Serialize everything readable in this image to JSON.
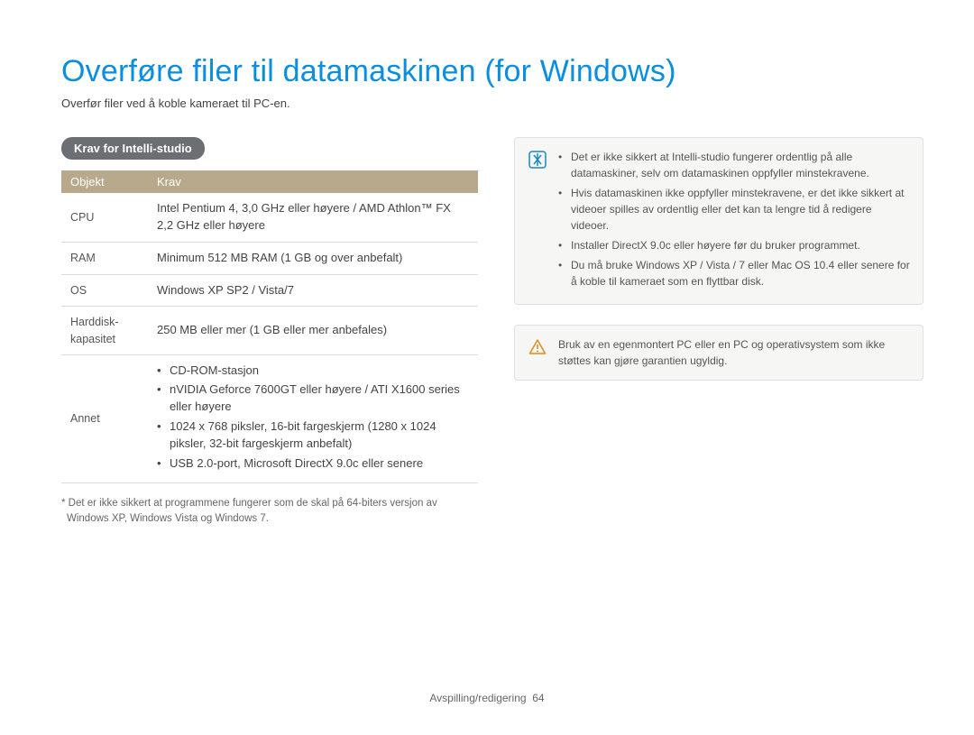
{
  "title": "Overføre filer til datamaskinen (for Windows)",
  "subtitle": "Overfør filer ved å koble kameraet til PC-en.",
  "section_heading": "Krav for Intelli-studio",
  "table": {
    "headers": {
      "objekt": "Objekt",
      "krav": "Krav"
    },
    "rows": {
      "cpu": {
        "label": "CPU",
        "value": "Intel Pentium 4, 3,0 GHz eller høyere / AMD Athlon™ FX 2,2 GHz eller høyere"
      },
      "ram": {
        "label": "RAM",
        "value": "Minimum 512 MB RAM (1 GB og over anbefalt)"
      },
      "os": {
        "label": "OS",
        "value": "Windows XP SP2 / Vista/7"
      },
      "hdd": {
        "label": "Harddisk-kapasitet",
        "value": "250 MB eller mer (1 GB eller mer anbefales)"
      },
      "other": {
        "label": "Annet",
        "items": [
          "CD-ROM-stasjon",
          "nVIDIA Geforce 7600GT eller høyere / ATI X1600 series eller høyere",
          "1024 x 768 piksler, 16-bit fargeskjerm (1280 x 1024 piksler, 32-bit fargeskjerm anbefalt)",
          "USB 2.0-port, Microsoft DirectX 9.0c eller senere"
        ]
      }
    }
  },
  "footnote": "* Det er ikke sikkert at programmene fungerer som de skal på 64-biters versjon av Windows XP, Windows Vista og Windows 7.",
  "info_box": {
    "items": [
      "Det er ikke sikkert at Intelli-studio fungerer ordentlig på alle datamaskiner, selv om datamaskinen oppfyller minstekravene.",
      "Hvis datamaskinen ikke oppfyller minstekravene, er det ikke sikkert at videoer spilles av ordentlig eller det kan ta lengre tid å redigere videoer.",
      "Installer DirectX 9.0c eller høyere før du bruker programmet.",
      "Du må bruke Windows XP / Vista / 7 eller Mac OS 10.4 eller senere for å koble til kameraet som en flyttbar disk."
    ]
  },
  "warning_box": {
    "text": "Bruk av en egenmontert PC eller en PC og operativsystem som ikke støttes kan gjøre garantien ugyldig."
  },
  "footer": {
    "section": "Avspilling/redigering",
    "page": "64"
  }
}
